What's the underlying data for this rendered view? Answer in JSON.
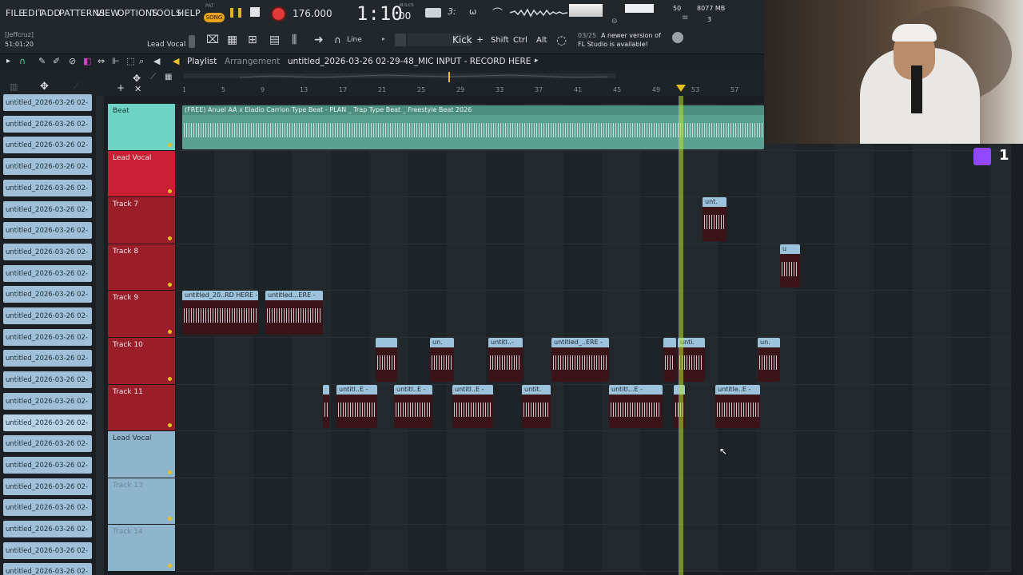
{
  "menu": [
    "FILE",
    "EDIT",
    "ADD",
    "PATTERNS",
    "VIEW",
    "OPTIONS",
    "TOOLS",
    "HELP"
  ],
  "transport": {
    "pat": "PAT",
    "song": "SONG",
    "tempo": "176.000",
    "time": "1:10",
    "time_small": "00",
    "time_unit": "M:S:CS",
    "cpu": "50",
    "ram": "8077 MB",
    "poly": "3"
  },
  "user": {
    "name": "[Jeffcruz]",
    "clock": "51:01:20"
  },
  "hint": {
    "channel": "Lead Vocal"
  },
  "snap": {
    "mode": "Line"
  },
  "keys": {
    "instrument": "Kick",
    "shift": "Shift",
    "ctrl": "Ctrl",
    "alt": "Alt"
  },
  "notice": {
    "date": "03/25",
    "line1": "A newer version of",
    "line2": "FL Studio is available!"
  },
  "playlist": {
    "title": "Playlist",
    "sub": "Arrangement",
    "project": "untitled_2026-03-26 02-29-48_MIC INPUT - RECORD HERE -"
  },
  "ruler": {
    "ticks": [
      "1",
      "5",
      "9",
      "13",
      "17",
      "21",
      "25",
      "29",
      "33",
      "37",
      "41",
      "45",
      "49",
      "53",
      "57"
    ]
  },
  "browser": {
    "item": "untitled_2026-03-26 02-",
    "count": 23
  },
  "tracks": [
    {
      "name": "Beat",
      "color": "#6fd3c4"
    },
    {
      "name": "Lead Vocal",
      "color": "#c81f34"
    },
    {
      "name": "Track 7",
      "color": "#9a1e2a"
    },
    {
      "name": "Track 8",
      "color": "#9a1e2a"
    },
    {
      "name": "Track 9",
      "color": "#9a1e2a"
    },
    {
      "name": "Track 10",
      "color": "#9a1e2a"
    },
    {
      "name": "Track 11",
      "color": "#9a1e2a"
    },
    {
      "name": "Lead Vocal",
      "color": "#8fb5cc"
    },
    {
      "name": "Track 13",
      "color": "#8fb5cc"
    },
    {
      "name": "Track 14",
      "color": "#8fb5cc"
    }
  ],
  "clips": {
    "beat": "(FREE) Anuel AA x Eladio Carrion Type Beat - PLAN _ Trap Type Beat _ Freestyle  Beat 2026",
    "t7": "unt.",
    "t8": "u",
    "t9a": "untitled_20..RD HERE -",
    "t9b": "untitled...ERE -",
    "t10": [
      "",
      "un.",
      "untitl..-",
      "untitled_..ERE -",
      "",
      "unti.",
      "un."
    ],
    "t11": [
      "",
      "untitl..E -",
      "untitl..E -",
      "untitl..E -",
      "untit.",
      "untitl...E -",
      "",
      "untitle..E -"
    ]
  },
  "stream": {
    "viewers": "1"
  },
  "colors": {
    "playhead": "#b8e03a",
    "beat": "#5aa28f",
    "vocal": "#8a1a24"
  }
}
